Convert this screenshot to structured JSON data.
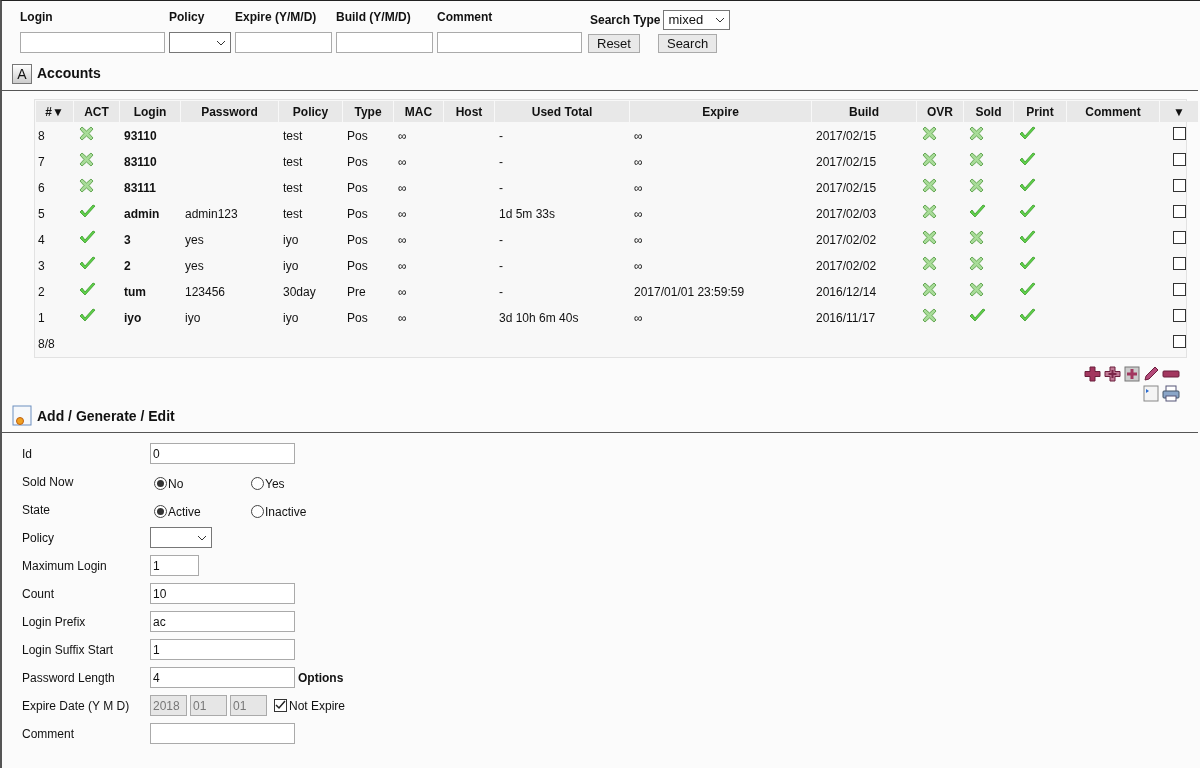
{
  "search": {
    "fields": [
      {
        "label": "Login",
        "kind": "text"
      },
      {
        "label": "Policy",
        "kind": "select"
      },
      {
        "label": "Expire (Y/M/D)",
        "kind": "text"
      },
      {
        "label": "Build (Y/M/D)",
        "kind": "text"
      },
      {
        "label": "Comment",
        "kind": "text"
      }
    ],
    "search_type": {
      "label": "Search Type",
      "value": "mixed"
    },
    "buttons": [
      "Reset",
      "Search"
    ]
  },
  "accounts": {
    "title": "Accounts",
    "icon_letter": "A",
    "columns": [
      "#▼",
      "ACT",
      "Login",
      "Password",
      "Policy",
      "Type",
      "MAC",
      "Host",
      "Used Total",
      "Expire",
      "Build",
      "OVR",
      "Sold",
      "Print",
      "Comment",
      "▼"
    ],
    "rows": [
      {
        "num": "8",
        "act": false,
        "login": "93110",
        "policy": "test",
        "type": "Pos",
        "mac": "∞",
        "used_total": "-",
        "expire": "∞",
        "build": "2017/02/15",
        "ovr": false,
        "sold": false,
        "print": true,
        "checked": false
      },
      {
        "num": "7",
        "act": false,
        "login": "83110",
        "policy": "test",
        "type": "Pos",
        "mac": "∞",
        "used_total": "-",
        "expire": "∞",
        "build": "2017/02/15",
        "ovr": false,
        "sold": false,
        "print": true,
        "checked": false
      },
      {
        "num": "6",
        "act": false,
        "login": "83111",
        "policy": "test",
        "type": "Pos",
        "mac": "∞",
        "used_total": "-",
        "expire": "∞",
        "build": "2017/02/15",
        "ovr": false,
        "sold": false,
        "print": true,
        "checked": false
      },
      {
        "num": "5",
        "act": true,
        "login": "admin",
        "password": "admin123",
        "policy": "test",
        "type": "Pos",
        "mac": "∞",
        "used_total": "1d 5m 33s",
        "expire": "∞",
        "build": "2017/02/03",
        "ovr": false,
        "sold": true,
        "print": true,
        "checked": false
      },
      {
        "num": "4",
        "act": true,
        "login": "3",
        "password": "yes",
        "policy": "iyo",
        "type": "Pos",
        "mac": "∞",
        "used_total": "-",
        "expire": "∞",
        "build": "2017/02/02",
        "ovr": false,
        "sold": false,
        "print": true,
        "checked": false
      },
      {
        "num": "3",
        "act": true,
        "login": "2",
        "password": "yes",
        "policy": "iyo",
        "type": "Pos",
        "mac": "∞",
        "used_total": "-",
        "expire": "∞",
        "build": "2017/02/02",
        "ovr": false,
        "sold": false,
        "print": true,
        "checked": false
      },
      {
        "num": "2",
        "act": true,
        "login": "tum",
        "password": "123456",
        "policy": "30day",
        "type": "Pre",
        "mac": "∞",
        "used_total": "-",
        "expire": "2017/01/01 23:59:59",
        "build": "2016/12/14",
        "ovr": false,
        "sold": false,
        "print": true,
        "checked": false
      },
      {
        "num": "1",
        "act": true,
        "login": "iyo",
        "password": "iyo",
        "policy": "iyo",
        "type": "Pos",
        "mac": "∞",
        "used_total": "3d 10h 6m 40s",
        "expire": "∞",
        "build": "2016/11/17",
        "ovr": false,
        "sold": true,
        "print": true,
        "checked": false
      }
    ],
    "footer": {
      "count": "8/8",
      "checked": false
    }
  },
  "form": {
    "title": "Add / Generate / Edit",
    "rows": [
      {
        "label": "Id",
        "kind": "text",
        "value": "0"
      },
      {
        "label": "Sold Now",
        "kind": "radio",
        "options": [
          {
            "label": "No",
            "selected": true
          },
          {
            "label": "Yes",
            "selected": false
          }
        ]
      },
      {
        "label": "State",
        "kind": "radio",
        "options": [
          {
            "label": "Active",
            "selected": true
          },
          {
            "label": "Inactive",
            "selected": false
          }
        ]
      },
      {
        "label": "Policy",
        "kind": "select"
      },
      {
        "label": "Maximum Login",
        "kind": "short",
        "value": "1"
      },
      {
        "label": "Count",
        "kind": "text",
        "value": "10"
      },
      {
        "label": "Login Prefix",
        "kind": "text",
        "value": "ac"
      },
      {
        "label": "Login Suffix Start",
        "kind": "text",
        "value": "1"
      },
      {
        "label": "Password Length",
        "kind": "text",
        "value": "4",
        "note": "Options"
      },
      {
        "label": "Expire Date (Y M D)",
        "kind": "date",
        "parts": [
          "2018",
          "01",
          "01"
        ],
        "disabled": true,
        "check": {
          "label": "Not Expire",
          "checked": true
        }
      },
      {
        "label": "Comment",
        "kind": "text"
      }
    ]
  }
}
